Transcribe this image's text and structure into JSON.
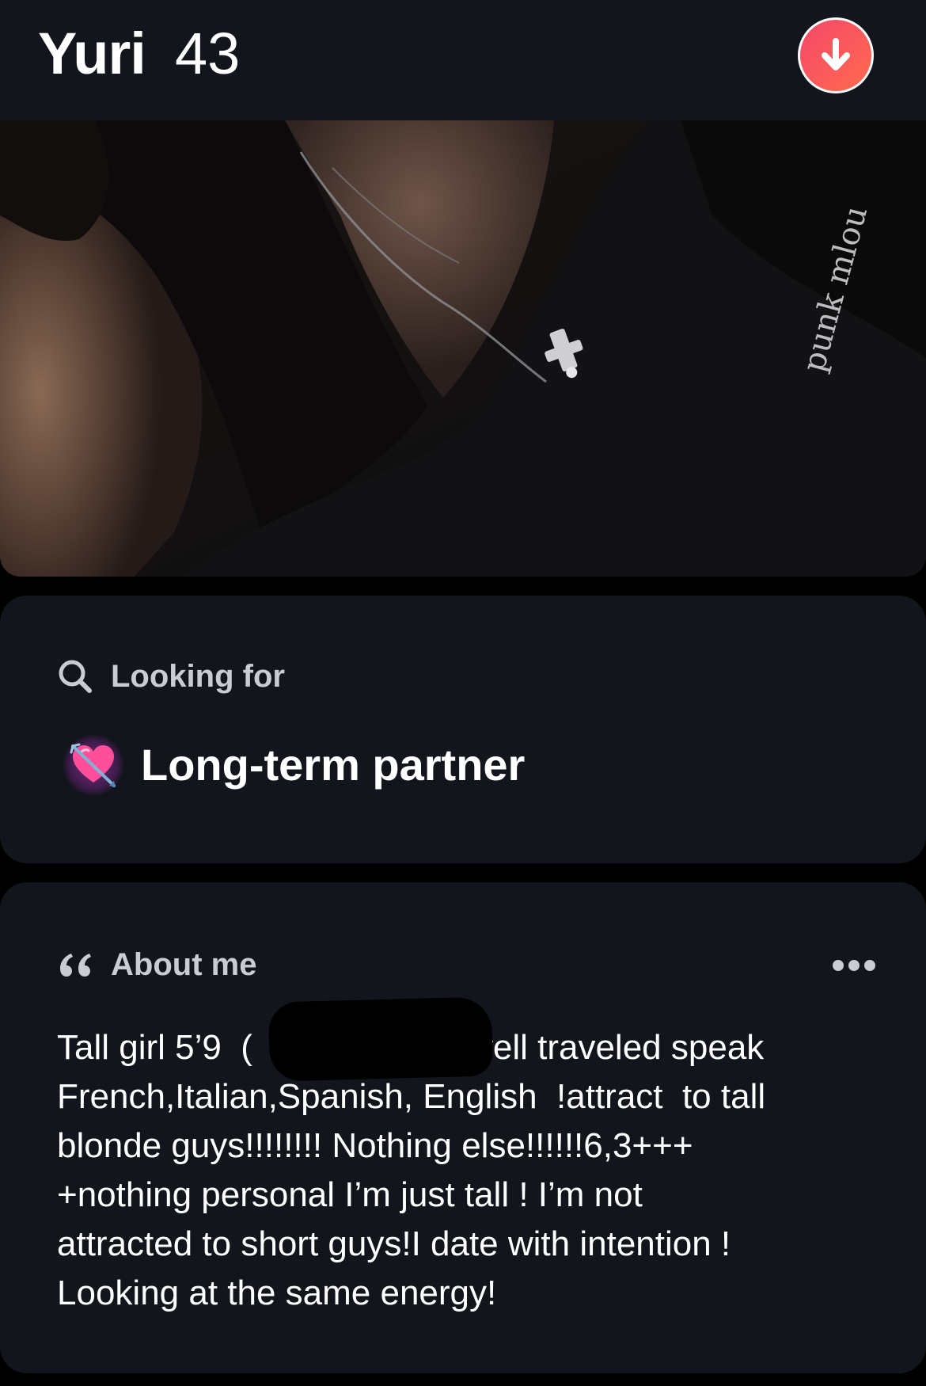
{
  "profile": {
    "name": "Yuri",
    "age": "43"
  },
  "actions": {
    "pass_icon": "arrow-down-icon",
    "pass_color": "#f5486b"
  },
  "photo": {
    "visible_text": "punk mlou"
  },
  "looking_for": {
    "label": "Looking for",
    "label_icon": "search-icon",
    "value": "Long-term partner",
    "value_icon": "heart-with-arrow-icon"
  },
  "about_me": {
    "label": "About me",
    "label_icon": "quote-icon",
    "menu_icon": "more-dots-icon",
    "bio_visible_text": "Tall girl 5’9 (e)well traveled speak French,Italian,Spanish, English !attract to tall blonde guys!!!!!!!! Nothing else!!!!!!6,3+++ +nothing personal I’m just tall ! I’m not attracted to short guys!I date with intention ! Looking at the same energy!",
    "bio_segments": {
      "line1_start": "Tall girl 5’9  (",
      "line1_end": "e)well traveled speak",
      "rest": "French,Italian,Spanish, English  !attract  to tall\nblonde guys!!!!!!!! Nothing else!!!!!!6,3+++\n+nothing personal I’m just tall ! I’m not\nattracted to short guys!I date with intention !\nLooking at the same energy!"
    }
  },
  "colors": {
    "card_background": "#12151b",
    "page_background": "#000000",
    "label_color": "#c9ccd3"
  }
}
